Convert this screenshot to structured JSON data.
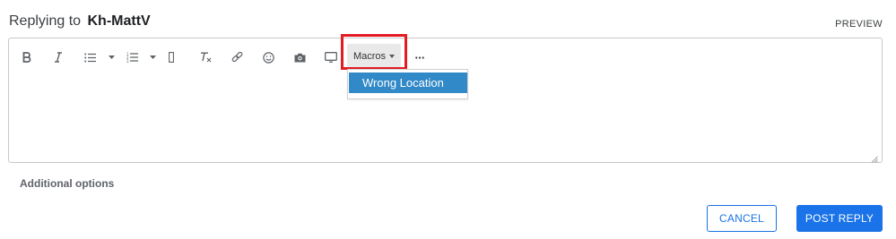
{
  "header": {
    "replying_prefix": "Replying to",
    "username": "Kh-MattV",
    "preview_label": "PREVIEW"
  },
  "toolbar": {
    "icons": [
      "bold-icon",
      "italic-icon",
      "bulleted-list-icon",
      "numbered-list-icon",
      "spoiler-icon",
      "clear-format-icon",
      "link-icon",
      "emoji-icon",
      "camera-icon",
      "video-icon",
      "more-icon"
    ],
    "macros_label": "Macros"
  },
  "macros_dropdown": {
    "items": [
      {
        "label": "Wrong Location"
      }
    ]
  },
  "editor": {
    "body_text": ""
  },
  "additional_options_label": "Additional options",
  "buttons": {
    "cancel_label": "CANCEL",
    "post_reply_label": "POST REPLY"
  },
  "colors": {
    "accent": "#1a73e8",
    "highlight": "#e31c23",
    "dropdown_selected": "#3189c8"
  }
}
